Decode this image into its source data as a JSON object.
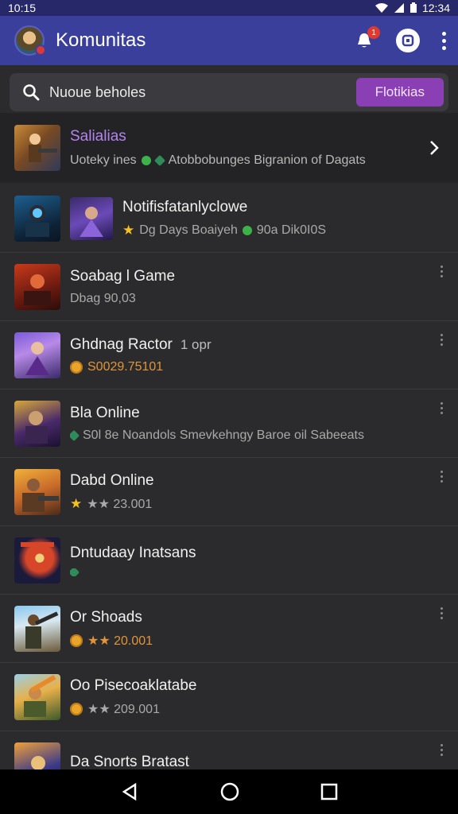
{
  "status_bar": {
    "time": "10:15",
    "clock": "12:34"
  },
  "app_bar": {
    "title": "Komunitas",
    "notification_count": "1"
  },
  "search": {
    "placeholder": "Nuoue beholes",
    "action_label": "Flotikias"
  },
  "featured": {
    "title": "Salialias",
    "subtitle_left": "Uoteky ines",
    "subtitle_right": "Atobbobunges Bigranion of Dagats"
  },
  "games": [
    {
      "title": "Notifisfatanlyclowe",
      "sub_a": "Dg Days Boaiyeh",
      "sub_b": "90a Dik0I0S",
      "double_thumb": true
    },
    {
      "title": "Soabag l Game",
      "subtitle": "Dbag 90,03"
    },
    {
      "title": "Ghdnag Ractor",
      "extra": "1 opr",
      "subtitle": "S0029.75101"
    },
    {
      "title": "Bla Online",
      "subtitle": "S0l 8e Noandols Smevkehngy Baroe oil Sabeeats"
    },
    {
      "title": "Dabd Online",
      "subtitle": "★★ 23.001"
    },
    {
      "title": "Dntudaay Inatsans",
      "subtitle": ""
    },
    {
      "title": "Or Shoads",
      "subtitle": "★★ 20.001"
    },
    {
      "title": "Oo Pisecoaklatabe",
      "subtitle": "★★ 209.001"
    },
    {
      "title": "Da Snorts Bratast",
      "subtitle": ""
    }
  ],
  "colors": {
    "app_bar": "#3a3f9c",
    "accent": "#8b3fb4",
    "background": "#2b2b2d",
    "featured_title": "#b384ec"
  }
}
